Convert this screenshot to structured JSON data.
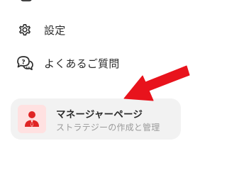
{
  "menu": {
    "items": [
      {
        "label": "設定",
        "icon": "gear-icon"
      },
      {
        "label": "よくあるご質問",
        "icon": "chat-bubbles-question-icon"
      }
    ]
  },
  "manager_card": {
    "title": "マネージャーページ",
    "subtitle": "ストラテジーの作成と管理",
    "icon": "manager-person-icon",
    "colors": {
      "card_bg": "#f2f2f2",
      "icon_bg": "#ffe1e1",
      "icon_accent": "#e02424"
    }
  },
  "overlay": {
    "arrow_color": "#e8131c"
  }
}
